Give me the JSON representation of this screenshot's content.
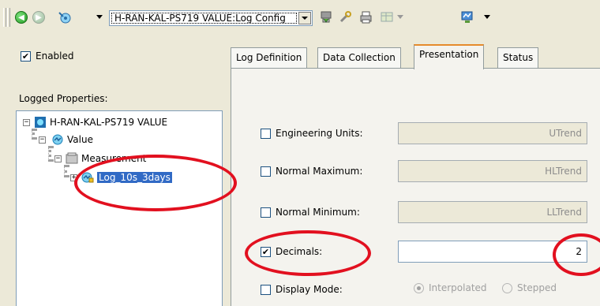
{
  "toolbar": {
    "path_value": "H-RAN-KAL-PS719 VALUE:Log Config",
    "icons": [
      "back-icon",
      "forward-icon",
      "connect-icon",
      "save-icon",
      "tools-icon",
      "print-icon",
      "table-icon",
      "monitor-icon"
    ]
  },
  "left": {
    "enabled_label": "Enabled",
    "enabled_checked": "✔",
    "logged_label": "Logged Properties:",
    "tree": {
      "root": "H-RAN-KAL-PS719 VALUE",
      "value": "Value",
      "measurement": "Measurement",
      "log": "Log_10s_3days",
      "expander_minus": "−",
      "expander_plus": "+"
    }
  },
  "tabs": [
    {
      "label": "Log Definition"
    },
    {
      "label": "Data Collection"
    },
    {
      "label": "Presentation"
    },
    {
      "label": "Status"
    }
  ],
  "presentation": {
    "engineering_units": {
      "label": "Engineering Units:",
      "value": "UTrend"
    },
    "normal_maximum": {
      "label": "Normal Maximum:",
      "value": "HLTrend"
    },
    "normal_minimum": {
      "label": "Normal Minimum:",
      "value": "LLTrend"
    },
    "decimals": {
      "label": "Decimals:",
      "value": "2",
      "checked": "✔"
    },
    "display_mode": {
      "label": "Display Mode:",
      "option_interpolated": "Interpolated",
      "option_stepped": "Stepped"
    }
  },
  "colors": {
    "annotation": "#e2101f",
    "selection": "#316ac5",
    "tab_accent": "#e68b2c"
  }
}
